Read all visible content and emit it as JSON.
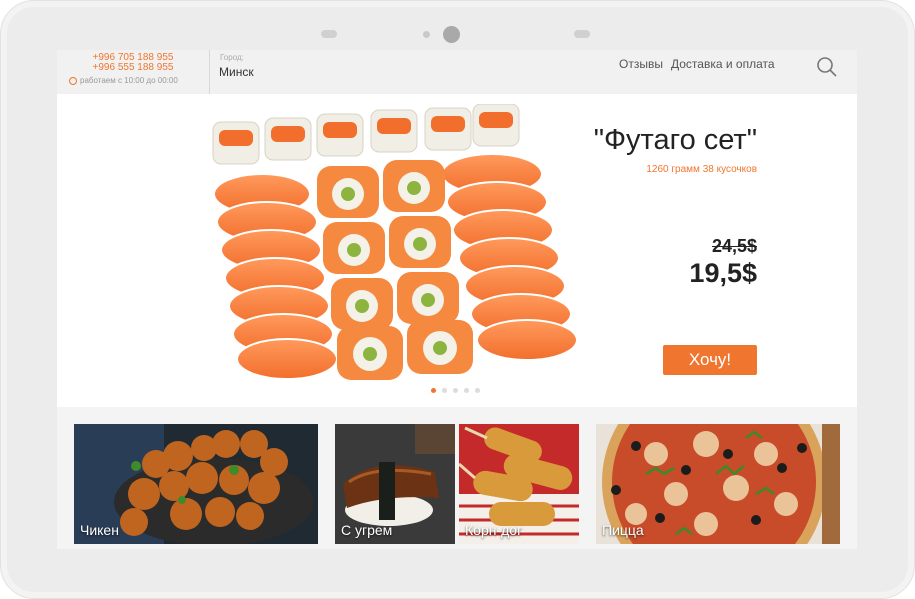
{
  "header": {
    "phones": [
      "+996 705 188 955",
      "+996 555 188 955"
    ],
    "hours": "работаем с 10:00 до 00:00",
    "city_label": "Город:",
    "city": "Минск",
    "nav": [
      "Отзывы",
      "Доставка и оплата"
    ]
  },
  "hero": {
    "title": "\"Футаго сет\"",
    "subtitle": "1260 грамм 38 кусочков",
    "old_price": "24,5$",
    "price": "19,5$",
    "cta": "Хочу!",
    "slides": 5,
    "active_slide": 1
  },
  "categories": [
    {
      "label": "Чикен"
    },
    {
      "label": "С угрем"
    },
    {
      "label": "Корн-дог"
    },
    {
      "label": "Пицца"
    }
  ],
  "colors": {
    "accent": "#f0762f",
    "header_bg": "#f1f1f1"
  }
}
